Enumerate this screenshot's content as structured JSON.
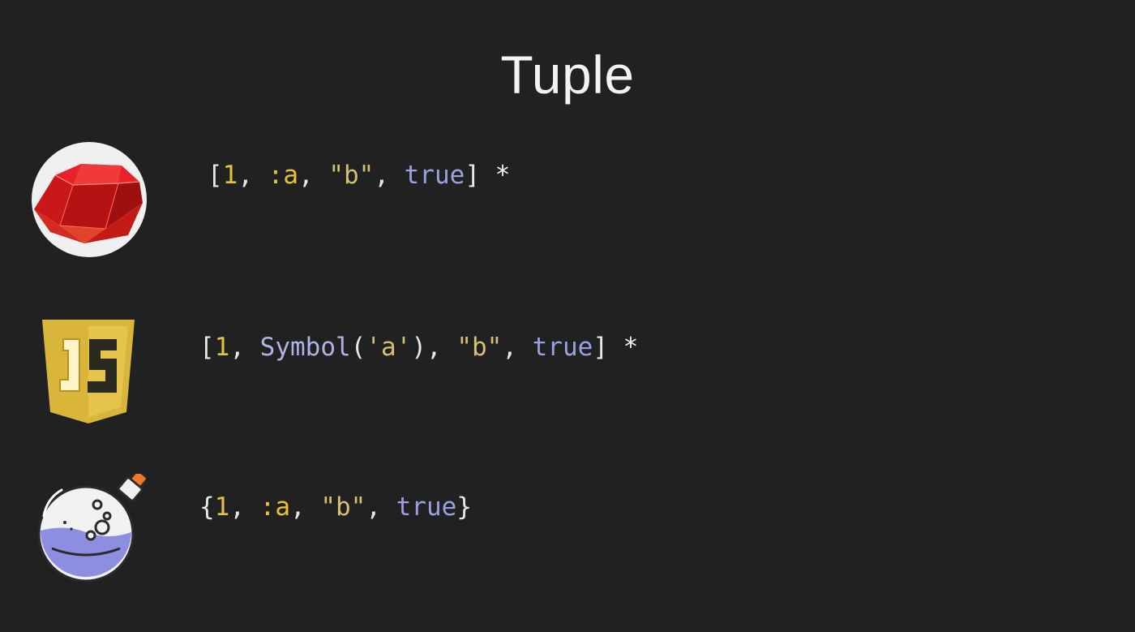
{
  "slide": {
    "title": "Tuple"
  },
  "rows": [
    {
      "language_icon": "ruby-icon",
      "tokens": [
        {
          "text": "[",
          "kind": "punct"
        },
        {
          "text": "1",
          "kind": "num"
        },
        {
          "text": ", ",
          "kind": "punct"
        },
        {
          "text": ":a",
          "kind": "sym"
        },
        {
          "text": ", ",
          "kind": "punct"
        },
        {
          "text": "\"b\"",
          "kind": "str"
        },
        {
          "text": ", ",
          "kind": "punct"
        },
        {
          "text": "true",
          "kind": "kw"
        },
        {
          "text": "] ",
          "kind": "punct"
        },
        {
          "text": "*",
          "kind": "star"
        }
      ]
    },
    {
      "language_icon": "javascript-icon",
      "tokens": [
        {
          "text": "[",
          "kind": "punct"
        },
        {
          "text": "1",
          "kind": "num"
        },
        {
          "text": ", ",
          "kind": "punct"
        },
        {
          "text": "Symbol",
          "kind": "fn"
        },
        {
          "text": "(",
          "kind": "punct"
        },
        {
          "text": "'a'",
          "kind": "str"
        },
        {
          "text": "), ",
          "kind": "punct"
        },
        {
          "text": "\"b\"",
          "kind": "str"
        },
        {
          "text": ", ",
          "kind": "punct"
        },
        {
          "text": "true",
          "kind": "kw"
        },
        {
          "text": "] ",
          "kind": "punct"
        },
        {
          "text": "*",
          "kind": "star"
        }
      ]
    },
    {
      "language_icon": "elixir-icon",
      "tokens": [
        {
          "text": "{",
          "kind": "punct"
        },
        {
          "text": "1",
          "kind": "num"
        },
        {
          "text": ", ",
          "kind": "punct"
        },
        {
          "text": ":a",
          "kind": "sym"
        },
        {
          "text": ", ",
          "kind": "punct"
        },
        {
          "text": "\"b\"",
          "kind": "str"
        },
        {
          "text": ", ",
          "kind": "punct"
        },
        {
          "text": "true",
          "kind": "kw"
        },
        {
          "text": "}",
          "kind": "punct"
        }
      ]
    }
  ],
  "colors": {
    "background": "#212121",
    "punctuation": "#e8e8e8",
    "number": "#e6c23a",
    "symbol": "#e6c23a",
    "string": "#d4c173",
    "keyword": "#9aa0e0",
    "function": "#b0b3e6"
  }
}
